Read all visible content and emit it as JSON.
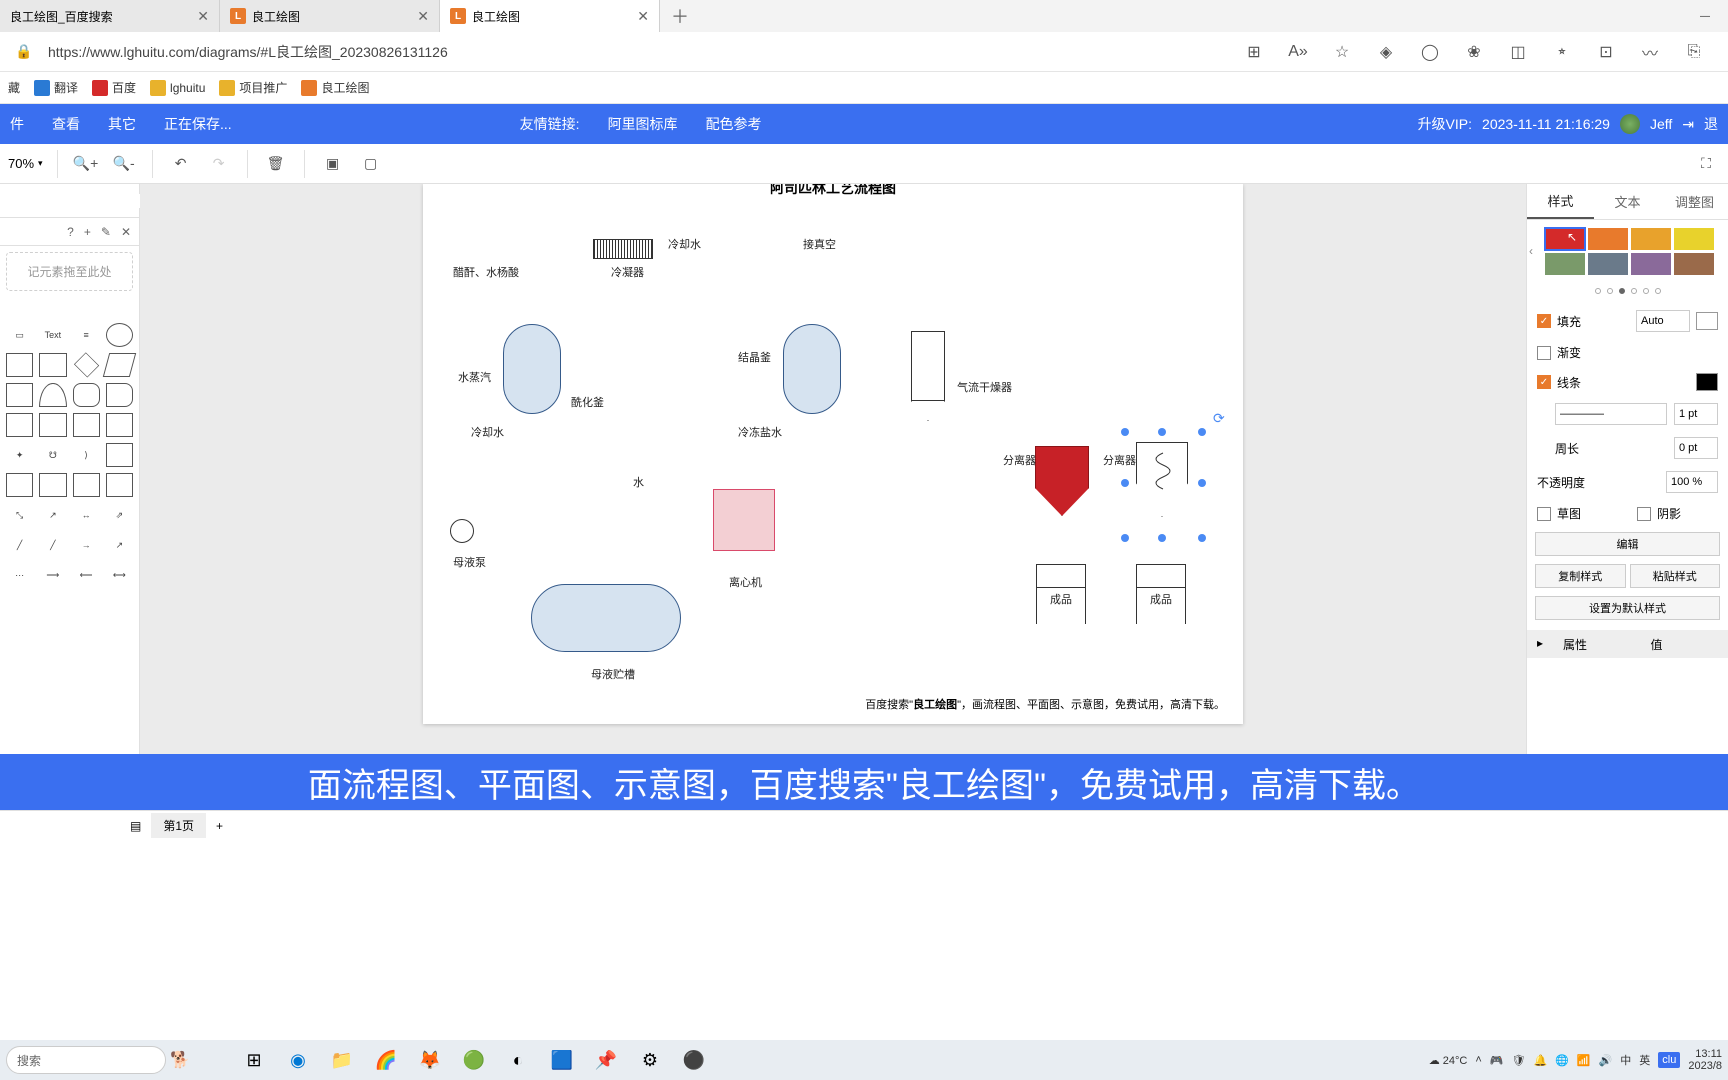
{
  "tabs": [
    {
      "label": "良工绘图_百度搜索",
      "active": false
    },
    {
      "label": "良工绘图",
      "active": false
    },
    {
      "label": "良工绘图",
      "active": true
    }
  ],
  "url": "https://www.lghuitu.com/diagrams/#L良工绘图_20230826131126",
  "bookmarks": [
    {
      "label": "藏"
    },
    {
      "label": "翻译"
    },
    {
      "label": "百度"
    },
    {
      "label": "lghuitu"
    },
    {
      "label": "项目推广"
    },
    {
      "label": "良工绘图"
    }
  ],
  "appmenu": {
    "file": "件",
    "view": "查看",
    "other": "其它",
    "saving": "正在保存...",
    "links": "友情链接:",
    "link1": "阿里图标库",
    "link2": "配色参考",
    "vip": "升级VIP:",
    "date": "2023-11-11 21:16:29",
    "user": "Jeff",
    "logout": "退"
  },
  "zoom": "70%",
  "leftpanel": {
    "question": "?",
    "plus": "+",
    "edit": "✎",
    "close": "✕",
    "drop": "记元素拖至此处"
  },
  "diagram": {
    "title": "阿司匹林工艺流程图",
    "labels": {
      "condenser": "冷凝器",
      "coolwater": "冷却水",
      "vacuum": "接真空",
      "materials": "醋酐、水杨酸",
      "steam": "水蒸汽",
      "acylation": "酰化釜",
      "coolwater2": "冷却水",
      "crystal": "结晶釜",
      "frozen": "冷冻盐水",
      "waterin": "水",
      "centrifuge": "离心机",
      "dryer": "气流干燥器",
      "separator": "分离器",
      "separator2": "分离器",
      "product1": "成品",
      "product2": "成品",
      "pump": "母液泵",
      "mothertank": "母液贮槽"
    },
    "footer_prefix": "百度搜索\"",
    "footer_bold": "良工绘图",
    "footer_suffix": "\"，画流程图、平面图、示意图，免费试用，高清下载。"
  },
  "right": {
    "tabs": {
      "style": "样式",
      "text": "文本",
      "adjust": "调整图"
    },
    "swatches": [
      [
        "#d42a2a",
        "#e87a2c",
        "#e8a22c",
        "#e8d22c"
      ],
      [
        "#7a9a6a",
        "#6a7a8a",
        "#8a6a9a",
        "#9a6a4a"
      ]
    ],
    "fill": "填充",
    "auto": "Auto",
    "gradient": "渐变",
    "line": "线条",
    "pt": "1 pt",
    "perimeter": "周长",
    "perim_val": "0 pt",
    "opacity": "不透明度",
    "opac_val": "100 %",
    "sketch": "草图",
    "shadow": "阴影",
    "edit": "编辑",
    "copy": "复制样式",
    "paste": "粘贴样式",
    "default": "设置为默认样式",
    "attr": "属性",
    "value": "值"
  },
  "promo": "面流程图、平面图、示意图，百度搜索\"良工绘图\"，免费试用，高清下载。",
  "pagebar": {
    "page": "第1页",
    "plus": "+"
  },
  "taskbar": {
    "search": "搜索",
    "weather": "24°C",
    "tray": {
      "ime1": "中",
      "ime2": "英",
      "time": "13:11",
      "date": "2023/8"
    }
  }
}
